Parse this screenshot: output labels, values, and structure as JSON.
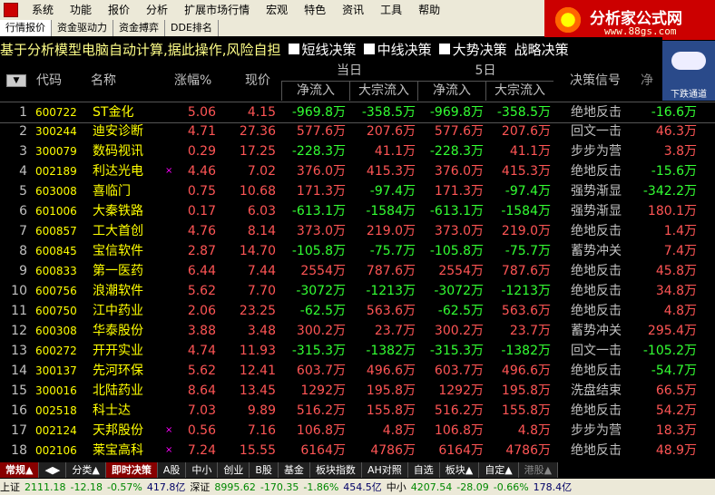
{
  "menu": [
    "系统",
    "功能",
    "报价",
    "分析",
    "扩展市场行情",
    "宏观",
    "特色",
    "资讯",
    "工具",
    "帮助"
  ],
  "menu_right": "行",
  "logo": {
    "title": "分析家公式网",
    "url": "www.88gs.com"
  },
  "tabs": [
    "行情报价",
    "资金驱动力",
    "资金搏弈",
    "DDE排名"
  ],
  "marquee": "基于分析模型电脑自动计算,据此操作,风险自担",
  "options": [
    "短线决策",
    "中线决策",
    "大势决策",
    "战略决策"
  ],
  "weather_label": "下跌通道",
  "headers": {
    "code": "代码",
    "name": "名称",
    "chg": "涨幅%",
    "price": "现价",
    "group1": "当日",
    "group2": "5日",
    "netflow": "净流入",
    "bigflow": "大宗流入",
    "signal": "决策信号",
    "last": "净"
  },
  "rows": [
    {
      "n": "1",
      "code": "600722",
      "name": "ST金化",
      "mark": "",
      "chg": "5.06",
      "price": "4.15",
      "f1": "-969.8万",
      "f2": "-358.5万",
      "f3": "-969.8万",
      "f4": "-358.5万",
      "sig": "绝地反击",
      "last": "-16.6万"
    },
    {
      "n": "2",
      "code": "300244",
      "name": "迪安诊断",
      "mark": "",
      "chg": "4.71",
      "price": "27.36",
      "f1": "577.6万",
      "f2": "207.6万",
      "f3": "577.6万",
      "f4": "207.6万",
      "sig": "回文一击",
      "last": "46.3万"
    },
    {
      "n": "3",
      "code": "300079",
      "name": "数码视讯",
      "mark": "",
      "chg": "0.29",
      "price": "17.25",
      "f1": "-228.3万",
      "f2": "41.1万",
      "f3": "-228.3万",
      "f4": "41.1万",
      "sig": "步步为营",
      "last": "3.8万"
    },
    {
      "n": "4",
      "code": "002189",
      "name": "利达光电",
      "mark": "×",
      "chg": "4.46",
      "price": "7.02",
      "f1": "376.0万",
      "f2": "415.3万",
      "f3": "376.0万",
      "f4": "415.3万",
      "sig": "绝地反击",
      "last": "-15.6万"
    },
    {
      "n": "5",
      "code": "603008",
      "name": "喜临门",
      "mark": "",
      "chg": "0.75",
      "price": "10.68",
      "f1": "171.3万",
      "f2": "-97.4万",
      "f3": "171.3万",
      "f4": "-97.4万",
      "sig": "强势渐显",
      "last": "-342.2万"
    },
    {
      "n": "6",
      "code": "601006",
      "name": "大秦铁路",
      "mark": "",
      "chg": "0.17",
      "price": "6.03",
      "f1": "-613.1万",
      "f2": "-1584万",
      "f3": "-613.1万",
      "f4": "-1584万",
      "sig": "强势渐显",
      "last": "180.1万"
    },
    {
      "n": "7",
      "code": "600857",
      "name": "工大首创",
      "mark": "",
      "chg": "4.76",
      "price": "8.14",
      "f1": "373.0万",
      "f2": "219.0万",
      "f3": "373.0万",
      "f4": "219.0万",
      "sig": "绝地反击",
      "last": "1.4万"
    },
    {
      "n": "8",
      "code": "600845",
      "name": "宝信软件",
      "mark": "",
      "chg": "2.87",
      "price": "14.70",
      "f1": "-105.8万",
      "f2": "-75.7万",
      "f3": "-105.8万",
      "f4": "-75.7万",
      "sig": "蓄势冲关",
      "last": "7.4万"
    },
    {
      "n": "9",
      "code": "600833",
      "name": "第一医药",
      "mark": "",
      "chg": "6.44",
      "price": "7.44",
      "f1": "2554万",
      "f2": "787.6万",
      "f3": "2554万",
      "f4": "787.6万",
      "sig": "绝地反击",
      "last": "45.8万"
    },
    {
      "n": "10",
      "code": "600756",
      "name": "浪潮软件",
      "mark": "",
      "chg": "5.62",
      "price": "7.70",
      "f1": "-3072万",
      "f2": "-1213万",
      "f3": "-3072万",
      "f4": "-1213万",
      "sig": "绝地反击",
      "last": "34.8万"
    },
    {
      "n": "11",
      "code": "600750",
      "name": "江中药业",
      "mark": "",
      "chg": "2.06",
      "price": "23.25",
      "f1": "-62.5万",
      "f2": "563.6万",
      "f3": "-62.5万",
      "f4": "563.6万",
      "sig": "绝地反击",
      "last": "4.8万"
    },
    {
      "n": "12",
      "code": "600308",
      "name": "华泰股份",
      "mark": "",
      "chg": "3.88",
      "price": "3.48",
      "f1": "300.2万",
      "f2": "23.7万",
      "f3": "300.2万",
      "f4": "23.7万",
      "sig": "蓄势冲关",
      "last": "295.4万"
    },
    {
      "n": "13",
      "code": "600272",
      "name": "开开实业",
      "mark": "",
      "chg": "4.74",
      "price": "11.93",
      "f1": "-315.3万",
      "f2": "-1382万",
      "f3": "-315.3万",
      "f4": "-1382万",
      "sig": "回文一击",
      "last": "-105.2万"
    },
    {
      "n": "14",
      "code": "300137",
      "name": "先河环保",
      "mark": "",
      "chg": "5.62",
      "price": "12.41",
      "f1": "603.7万",
      "f2": "496.6万",
      "f3": "603.7万",
      "f4": "496.6万",
      "sig": "绝地反击",
      "last": "-54.7万"
    },
    {
      "n": "15",
      "code": "300016",
      "name": "北陆药业",
      "mark": "",
      "chg": "8.64",
      "price": "13.45",
      "f1": "1292万",
      "f2": "195.8万",
      "f3": "1292万",
      "f4": "195.8万",
      "sig": "洗盘结束",
      "last": "66.5万"
    },
    {
      "n": "16",
      "code": "002518",
      "name": "科士达",
      "mark": "",
      "chg": "7.03",
      "price": "9.89",
      "f1": "516.2万",
      "f2": "155.8万",
      "f3": "516.2万",
      "f4": "155.8万",
      "sig": "绝地反击",
      "last": "54.2万"
    },
    {
      "n": "17",
      "code": "002124",
      "name": "天邦股份",
      "mark": "×",
      "chg": "0.56",
      "price": "7.16",
      "f1": "106.8万",
      "f2": "4.8万",
      "f3": "106.8万",
      "f4": "4.8万",
      "sig": "步步为营",
      "last": "18.3万"
    },
    {
      "n": "18",
      "code": "002106",
      "name": "莱宝高科",
      "mark": "×",
      "chg": "7.24",
      "price": "15.55",
      "f1": "6164万",
      "f2": "4786万",
      "f3": "6164万",
      "f4": "4786万",
      "sig": "绝地反击",
      "last": "48.9万"
    }
  ],
  "bottom_tabs": [
    "常规▲",
    "◀▶",
    "分类▲",
    "即时决策",
    "A股",
    "中小",
    "创业",
    "B股",
    "基金",
    "板块指数",
    "AH对照",
    "自选",
    "板块▲",
    "自定▲",
    "港股▲"
  ],
  "status": {
    "sh_label": "上证",
    "sh_val": "2111.18",
    "sh_chg": "-12.18",
    "sh_pct": "-0.57%",
    "sh_amt": "417.8亿",
    "sz_label": "深证",
    "sz_val": "8995.62",
    "sz_chg": "-170.35",
    "sz_pct": "-1.86%",
    "sz_amt": "454.5亿",
    "zx_label": "中小",
    "zx_val": "4207.54",
    "zx_chg": "-28.09",
    "zx_pct": "-0.66%",
    "zx_amt": "178.4亿"
  },
  "colors": {
    "up": "#ff5555",
    "down": "#33ff33",
    "code": "#ffff00",
    "bg": "#000000"
  }
}
